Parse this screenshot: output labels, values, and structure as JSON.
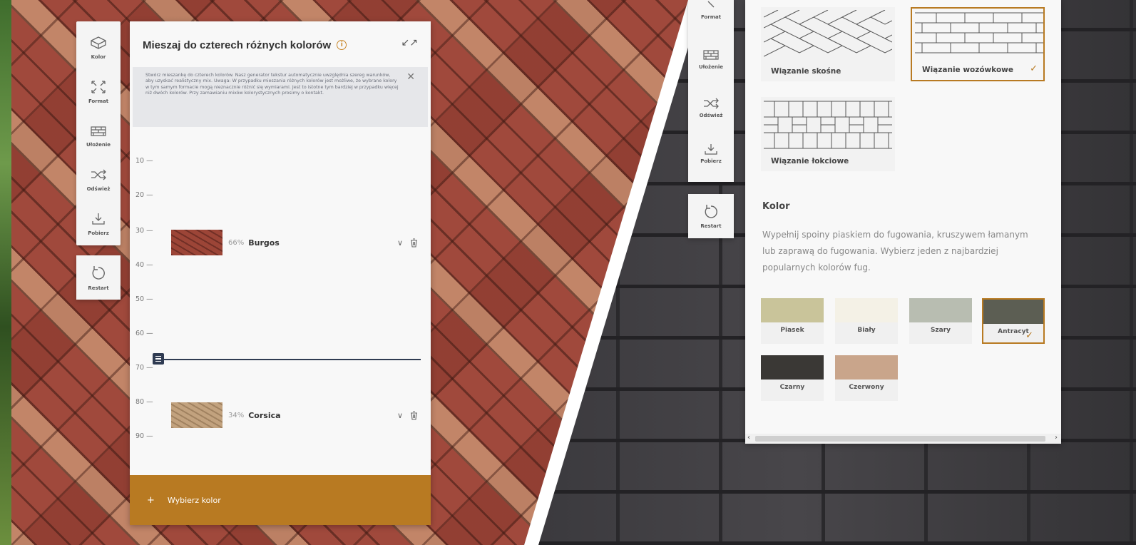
{
  "left_panel": {
    "tools": [
      {
        "label": "Kolor",
        "icon": "brick-icon"
      },
      {
        "label": "Format",
        "icon": "expand-icon"
      },
      {
        "label": "Ułożenie",
        "icon": "bricks-layout-icon"
      },
      {
        "label": "Odśwież",
        "icon": "shuffle-icon"
      },
      {
        "label": "Pobierz",
        "icon": "download-icon"
      }
    ],
    "restart_label": "Restart",
    "mixer": {
      "title": "Mieszaj do czterech różnych kolorów",
      "info_icon": "info-icon",
      "notice": "Stwórz mieszankę do czterech kolorów. Nasz generator tekstur automatycznie uwzględnia szereg warunków, aby uzyskać realistyczny mix. Uwaga: W przypadku mieszania różnych kolorów jest możliwe, że wybrane kolory w tym samym formacie mogą nieznacznie różnić się wymiarami. Jest to istotne tym bardziej w przypadku więcej niż dwóch kolorów. Przy zamawianiu mixów kolorystycznych prosimy o kontakt.",
      "scale": [
        "10 —",
        "20 —",
        "30 —",
        "40 —",
        "50 —",
        "60 —",
        "70 —",
        "80 —",
        "90 —"
      ],
      "colors": [
        {
          "percent": "66%",
          "name": "Burgos"
        },
        {
          "percent": "34%",
          "name": "Corsica"
        }
      ],
      "slider_value_percent": 66,
      "add_color_label": "Wybierz kolor",
      "add_color_plus": "+"
    }
  },
  "right_panel": {
    "tools": [
      {
        "label": "Format",
        "icon": "expand-icon"
      },
      {
        "label": "Ułożenie",
        "icon": "bricks-layout-icon"
      },
      {
        "label": "Odśwież",
        "icon": "shuffle-icon"
      },
      {
        "label": "Pobierz",
        "icon": "download-icon"
      }
    ],
    "restart_label": "Restart",
    "patterns": [
      {
        "label": "Wiązanie skośne",
        "selected": false
      },
      {
        "label": "Wiązanie wozówkowe",
        "selected": true
      },
      {
        "label": "Wiązanie łokciowe",
        "selected": false
      }
    ],
    "color_section": {
      "title": "Kolor",
      "description": "Wypełnij spoiny piaskiem do fugowania, kruszywem łamanym lub zaprawą do fugowania. Wybierz jeden z najbardziej popularnych kolorów fug.",
      "grouts": [
        {
          "label": "Piasek",
          "color": "#c9c49a",
          "selected": false
        },
        {
          "label": "Biały",
          "color": "#f4f1e6",
          "selected": false
        },
        {
          "label": "Szary",
          "color": "#b8bdb1",
          "selected": false
        },
        {
          "label": "Antracyt",
          "color": "#5c5e53",
          "selected": true
        },
        {
          "label": "Czarny",
          "color": "#3a3835",
          "selected": false
        },
        {
          "label": "Czerwony",
          "color": "#c9a58b",
          "selected": false
        }
      ]
    },
    "scroll_left": "‹",
    "scroll_right": "›"
  },
  "colors": {
    "accent": "#b87a22",
    "slider": "#2f3b52"
  }
}
